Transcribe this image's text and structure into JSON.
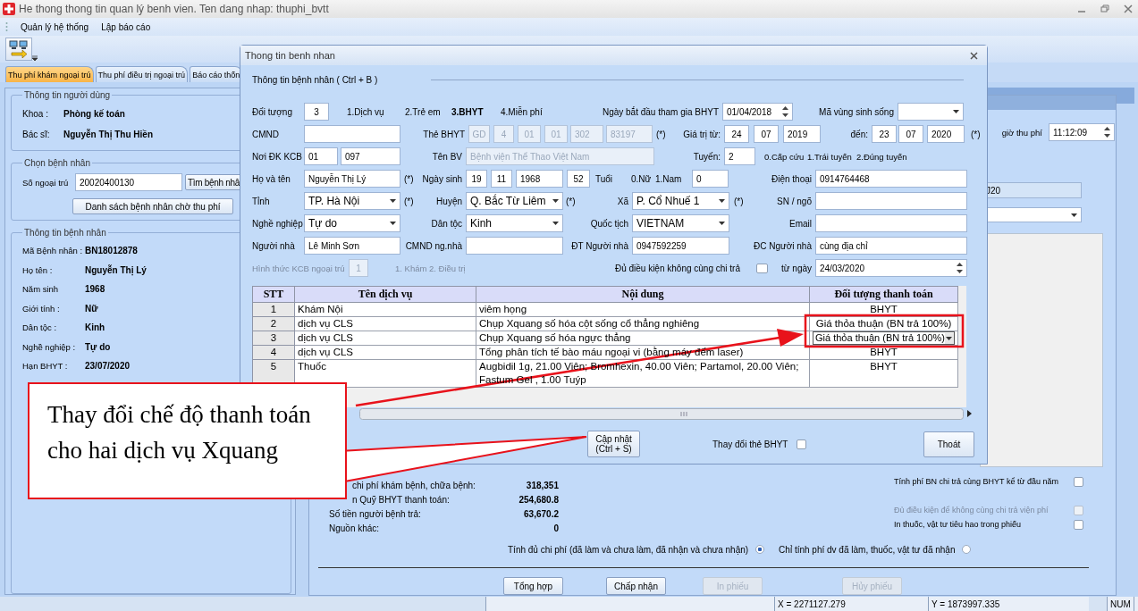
{
  "window": {
    "title": "He thong thong tin quan lý benh vien. Ten dang nhap: thuphi_bvtt"
  },
  "menu": [
    "Quản lý hệ thống",
    "Lập báo cáo"
  ],
  "tabs": [
    {
      "label": "Thu phí khám ngoại trú",
      "selected": true
    },
    {
      "label": "Thu phí điều trị ngoại trú",
      "selected": false
    },
    {
      "label": "Báo cáo thốn",
      "selected": false
    }
  ],
  "user_info": {
    "title": "Thông tin người dùng",
    "fields": [
      {
        "label": "Khoa :",
        "value": "Phòng kế toán"
      },
      {
        "label": "Bác sĩ:",
        "value": "Nguyễn Thị Thu Hiền"
      }
    ]
  },
  "patient_select": {
    "title": "Chọn bệnh nhân",
    "label": "Số ngoại trú",
    "value": "20020400130",
    "search_button": "Tìm bệnh nhâ",
    "list_button": "Danh sách bệnh nhân chờ thu phí"
  },
  "patient_info": {
    "title": "Thông tin bệnh nhân",
    "fields": [
      {
        "label": "Mã Bệnh nhân :",
        "value": "BN18012878"
      },
      {
        "label": "Họ tên :",
        "value": "Nguyễn Thị Lý"
      },
      {
        "label": "Năm sinh",
        "value": "1968"
      },
      {
        "label": "Giới tính :",
        "value": "Nữ"
      },
      {
        "label": "Dân tộc :",
        "value": "Kinh"
      },
      {
        "label": "Nghề nghiệp :",
        "value": "Tự do"
      },
      {
        "label": "Hạn BHYT :",
        "value": "23/07/2020"
      }
    ]
  },
  "fee_time": {
    "label": "giờ thu phí",
    "value": "11:12:09"
  },
  "diagnosis_code": "J20",
  "summary": [
    {
      "label": "chi phí khám bệnh, chữa bệnh:",
      "value": "318,351"
    },
    {
      "label": "n Quỹ BHYT thanh toán:",
      "value": "254,680.8"
    },
    {
      "label": "Số tiền người bệnh trả:",
      "value": "63,670.2"
    },
    {
      "label": "Nguồn khác:",
      "value": "0"
    }
  ],
  "options": [
    {
      "label": "Tính phí BN chi trả cùng BHYT kể từ đầu năm",
      "checked": false,
      "disabled": false
    },
    {
      "label": "Đủ điều kiện để không cùng chi trả viện phí",
      "checked": false,
      "disabled": true
    },
    {
      "label": "In thuốc, vật tư tiêu hao trong phiếu",
      "checked": false,
      "disabled": false
    }
  ],
  "cost_mode": [
    {
      "label": "Tính đủ chi phí (đã làm và chưa làm, đã nhận và chưa nhận)",
      "selected": true
    },
    {
      "label": "Chỉ tính phí dv đã làm, thuốc, vật tư đã nhận",
      "selected": false
    }
  ],
  "buttons": [
    {
      "label": "Tổng hợp",
      "disabled": false
    },
    {
      "label": "Chấp nhận",
      "disabled": false
    },
    {
      "label": "In phiếu",
      "disabled": true
    },
    {
      "label": "Hủy phiếu",
      "disabled": true
    }
  ],
  "dialog": {
    "title": "Thong tin benh nhan",
    "section": "Thông tin bệnh nhân ( Ctrl + B )",
    "form": [
      {
        "items": [
          {
            "kind": "label",
            "text": "Đối tượng"
          },
          {
            "kind": "field",
            "value": "3"
          },
          {
            "kind": "option",
            "text": "1.Dịch vụ",
            "selected": false
          },
          {
            "kind": "option",
            "text": "2.Trẻ em",
            "selected": false
          },
          {
            "kind": "option",
            "text": "3.BHYT",
            "selected": true
          },
          {
            "kind": "option",
            "text": "4.Miễn phí",
            "selected": false
          },
          {
            "kind": "label",
            "text": "Ngày bắt đầu tham gia BHYT"
          },
          {
            "kind": "spin",
            "value": "01/04/2018"
          },
          {
            "kind": "label",
            "text": "Mã vùng sinh sống"
          },
          {
            "kind": "combo"
          }
        ]
      },
      {
        "items": [
          {
            "kind": "label",
            "text": "CMND"
          },
          {
            "kind": "field"
          },
          {
            "kind": "label",
            "text": "Thẻ BHYT"
          },
          {
            "kind": "field",
            "value": "GD",
            "disabled": true
          },
          {
            "kind": "field",
            "value": "4",
            "disabled": true
          },
          {
            "kind": "field",
            "value": "01",
            "disabled": true
          },
          {
            "kind": "field",
            "value": "01",
            "disabled": true
          },
          {
            "kind": "field",
            "value": "302",
            "disabled": true
          },
          {
            "kind": "field",
            "value": "83197",
            "disabled": true
          },
          {
            "kind": "label",
            "text": "(*)"
          },
          {
            "kind": "label",
            "text": "Giá trị từ:"
          },
          {
            "kind": "field",
            "value": "24"
          },
          {
            "kind": "field",
            "value": "07"
          },
          {
            "kind": "field",
            "value": "2019"
          },
          {
            "kind": "label",
            "text": "đến:"
          },
          {
            "kind": "field",
            "value": "23"
          },
          {
            "kind": "field",
            "value": "07"
          },
          {
            "kind": "field",
            "value": "2020"
          },
          {
            "kind": "label",
            "text": "(*)"
          }
        ]
      },
      {
        "items": [
          {
            "kind": "label",
            "text": "Nơi ĐK KCB"
          },
          {
            "kind": "field",
            "value": "01"
          },
          {
            "kind": "field",
            "value": "097"
          },
          {
            "kind": "label",
            "text": "Tên BV"
          },
          {
            "kind": "field",
            "value": "Bệnh viện Thể Thao Việt Nam",
            "disabled": true
          },
          {
            "kind": "label",
            "text": "Tuyến:"
          },
          {
            "kind": "field",
            "value": "2"
          },
          {
            "kind": "label",
            "text": "0.Cấp cứu"
          },
          {
            "kind": "label",
            "text": "1.Trái tuyến"
          },
          {
            "kind": "label",
            "text": "2.Đúng tuyến"
          }
        ]
      },
      {
        "items": [
          {
            "kind": "label",
            "text": "Họ và tên"
          },
          {
            "kind": "field",
            "value": "Nguyễn Thị Lý"
          },
          {
            "kind": "label",
            "text": "(*)"
          },
          {
            "kind": "label",
            "text": "Ngày sinh"
          },
          {
            "kind": "field",
            "value": "19"
          },
          {
            "kind": "field",
            "value": "11"
          },
          {
            "kind": "field",
            "value": "1968"
          },
          {
            "kind": "field",
            "value": "52"
          },
          {
            "kind": "label",
            "text": "Tuổi"
          },
          {
            "kind": "label",
            "text": "0.Nữ"
          },
          {
            "kind": "label",
            "text": "1.Nam"
          },
          {
            "kind": "field",
            "value": "0"
          },
          {
            "kind": "label",
            "text": "Điện thoại"
          },
          {
            "kind": "field",
            "value": "0914764468"
          }
        ]
      },
      {
        "items": [
          {
            "kind": "label",
            "text": "Tỉnh"
          },
          {
            "kind": "combo",
            "value": "TP. Hà Nội"
          },
          {
            "kind": "label",
            "text": "(*)"
          },
          {
            "kind": "label",
            "text": "Huyện"
          },
          {
            "kind": "combo",
            "value": "Q. Bắc Từ Liêm"
          },
          {
            "kind": "label",
            "text": "(*)"
          },
          {
            "kind": "label",
            "text": "Xã"
          },
          {
            "kind": "combo",
            "value": "P. Cổ Nhuế 1"
          },
          {
            "kind": "label",
            "text": "(*)"
          },
          {
            "kind": "label",
            "text": "SN / ngõ"
          },
          {
            "kind": "field"
          }
        ]
      },
      {
        "items": [
          {
            "kind": "label",
            "text": "Nghề nghiệp"
          },
          {
            "kind": "combo",
            "value": "Tự do"
          },
          {
            "kind": "label",
            "text": "Dân tộc"
          },
          {
            "kind": "combo",
            "value": "Kinh"
          },
          {
            "kind": "label",
            "text": "Quốc tịch"
          },
          {
            "kind": "combo",
            "value": "VIETNAM"
          },
          {
            "kind": "label",
            "text": "Email"
          },
          {
            "kind": "field"
          }
        ]
      },
      {
        "items": [
          {
            "kind": "label",
            "text": "Người nhà"
          },
          {
            "kind": "field",
            "value": "Lê Minh Sơn"
          },
          {
            "kind": "label",
            "text": "CMND ng.nhà"
          },
          {
            "kind": "field"
          },
          {
            "kind": "label",
            "text": "ĐT Người nhà"
          },
          {
            "kind": "field",
            "value": "0947592259"
          },
          {
            "kind": "label",
            "text": "ĐC Người nhà"
          },
          {
            "kind": "field",
            "value": "cùng địa chỉ"
          }
        ]
      },
      {
        "items": [
          {
            "kind": "label",
            "text": "Hình thức KCB ngoại trú",
            "disabled": true
          },
          {
            "kind": "field",
            "value": "1",
            "disabled": true
          },
          {
            "kind": "label",
            "text": "1. Khám",
            "disabled": true
          },
          {
            "kind": "label",
            "text": "2. Điều trị",
            "disabled": true
          },
          {
            "kind": "label",
            "text": "Đủ điều kiện không cùng chi trả",
            "disabled": false
          },
          {
            "kind": "check",
            "checked": false
          },
          {
            "kind": "label",
            "text": "từ ngày",
            "disabled": false
          },
          {
            "kind": "spin",
            "value": "24/03/2020"
          }
        ]
      }
    ],
    "table": {
      "columns": [
        "STT",
        "Tên dịch vụ",
        "Nội dung",
        "Đối tượng thanh toán"
      ],
      "rows": [
        {
          "stt": "1",
          "service": "Khám Nội",
          "content": "viêm họng",
          "payer": "BHYT",
          "kind": "text"
        },
        {
          "stt": "2",
          "service": "dịch vụ CLS",
          "content": "Chụp Xquang số hóa cột sống cổ thẳng nghiêng",
          "payer": "Giá thỏa thuận (BN trả 100%)",
          "kind": "text"
        },
        {
          "stt": "3",
          "service": "dịch vụ CLS",
          "content": "Chụp Xquang số hóa ngực thẳng",
          "payer": "Giá thỏa thuận (BN trả 100%)",
          "kind": "combo"
        },
        {
          "stt": "4",
          "service": "dịch vụ CLS",
          "content": "Tổng phân tích tế bào máu ngoại vi (bằng máy đếm laser)",
          "payer": "BHYT",
          "kind": "text"
        },
        {
          "stt": "5",
          "service": "Thuốc",
          "content": "Augbidil 1g, 21.00 Viên; Bromhexin, 40.00 Viên; Partamol, 20.00 Viên; Fastum Gel , 1.00 Tuýp",
          "payer": "BHYT",
          "kind": "text"
        }
      ]
    },
    "update_button": "Cập nhật (Ctrl + S)",
    "change_card": {
      "label": "Thay đổi thẻ BHYT",
      "checked": false
    },
    "exit_button": "Thoát"
  },
  "callout": "Thay đổi chế độ thanh toán cho hai dịch vụ Xquang",
  "status_bar": [
    "X = 2271127.279",
    "Y = 1873997.335",
    "NUM"
  ]
}
